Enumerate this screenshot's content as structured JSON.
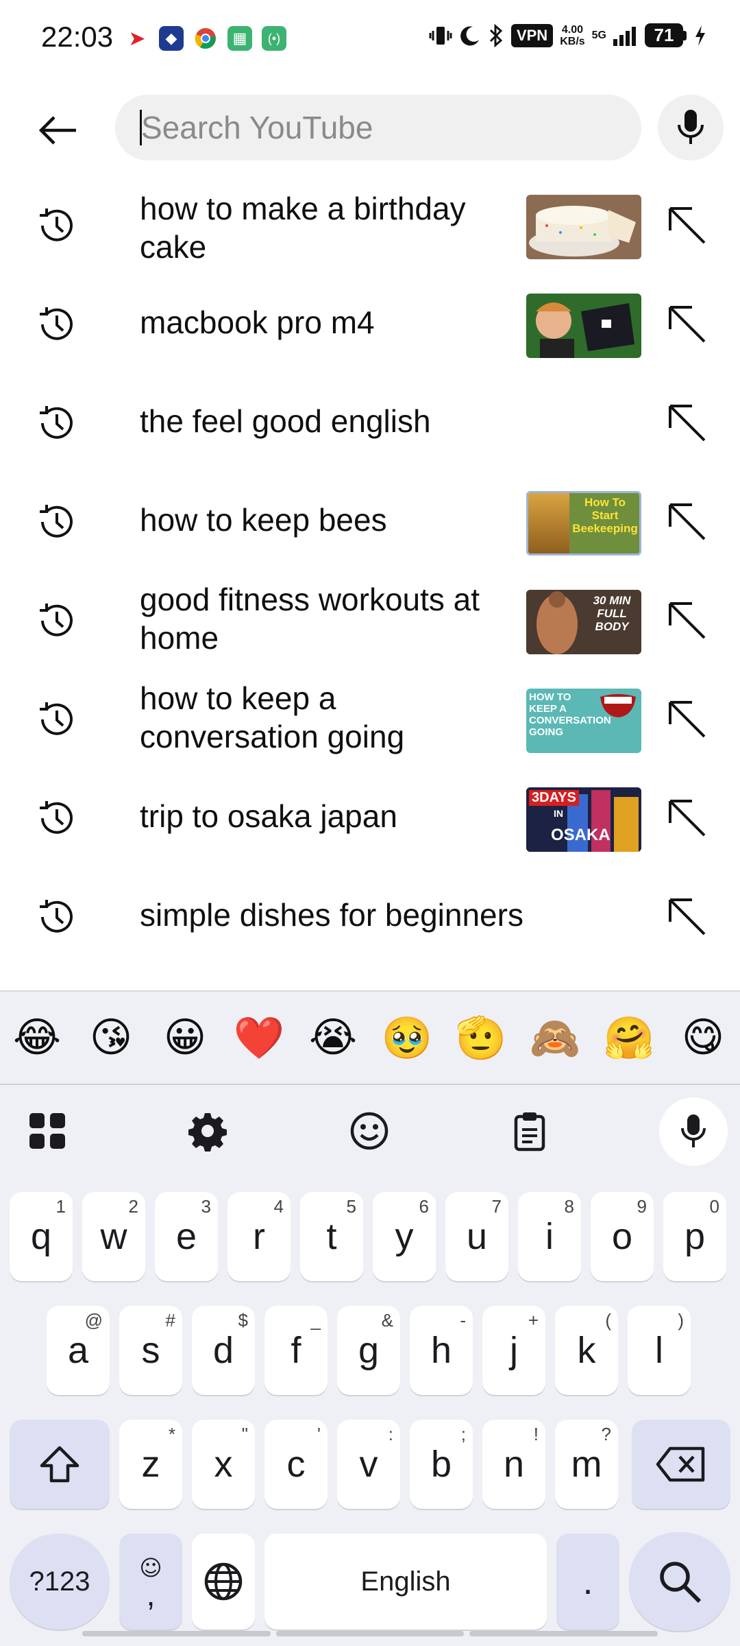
{
  "status_bar": {
    "time": "22:03",
    "vpn": "VPN",
    "speed_value": "4.00",
    "speed_unit": "KB/s",
    "network": "5G",
    "battery": "71"
  },
  "search": {
    "placeholder": "Search YouTube"
  },
  "suggestions": [
    {
      "text": "how to make a birthday cake",
      "thumbnail": "cake"
    },
    {
      "text": "macbook pro m4",
      "thumbnail": "laptop"
    },
    {
      "text": "the feel good english",
      "thumbnail": null
    },
    {
      "text": "how to keep bees",
      "thumbnail": "bees",
      "thumb_text": "How To Start Beekeeping"
    },
    {
      "text": "good fitness workouts at home",
      "thumbnail": "fitness",
      "thumb_text": "30 MIN FULL BODY"
    },
    {
      "text": "how to keep a conversation going",
      "thumbnail": "conversation",
      "thumb_text": "HOW TO KEEP A CONVERSATION GOING"
    },
    {
      "text": "trip to osaka japan",
      "thumbnail": "osaka",
      "thumb_text_1": "3DAYS",
      "thumb_text_2": "IN",
      "thumb_text_3": "OSAKA"
    },
    {
      "text": "simple dishes for beginners",
      "thumbnail": null
    }
  ],
  "emoji_row": [
    "😂",
    "😘",
    "😀",
    "❤️",
    "😭",
    "🥹",
    "🫡",
    "🙈",
    "🤗",
    "😋"
  ],
  "keyboard": {
    "row1": [
      {
        "key": "q",
        "hint": "1"
      },
      {
        "key": "w",
        "hint": "2"
      },
      {
        "key": "e",
        "hint": "3"
      },
      {
        "key": "r",
        "hint": "4"
      },
      {
        "key": "t",
        "hint": "5"
      },
      {
        "key": "y",
        "hint": "6"
      },
      {
        "key": "u",
        "hint": "7"
      },
      {
        "key": "i",
        "hint": "8"
      },
      {
        "key": "o",
        "hint": "9"
      },
      {
        "key": "p",
        "hint": "0"
      }
    ],
    "row2": [
      {
        "key": "a",
        "hint": "@"
      },
      {
        "key": "s",
        "hint": "#"
      },
      {
        "key": "d",
        "hint": "$"
      },
      {
        "key": "f",
        "hint": "_"
      },
      {
        "key": "g",
        "hint": "&"
      },
      {
        "key": "h",
        "hint": "-"
      },
      {
        "key": "j",
        "hint": "+"
      },
      {
        "key": "k",
        "hint": "("
      },
      {
        "key": "l",
        "hint": ")"
      }
    ],
    "row3": [
      {
        "key": "z",
        "hint": "*"
      },
      {
        "key": "x",
        "hint": "\""
      },
      {
        "key": "c",
        "hint": "'"
      },
      {
        "key": "v",
        "hint": ":"
      },
      {
        "key": "b",
        "hint": ";"
      },
      {
        "key": "n",
        "hint": "!"
      },
      {
        "key": "m",
        "hint": "?"
      }
    ],
    "symbols_label": "?123",
    "comma_label": ",",
    "space_label": "English",
    "period_label": "."
  },
  "colors": {
    "search_bg": "#f0f0f0",
    "keyboard_bg": "#eef0f5",
    "special_key": "#dde0f2"
  }
}
